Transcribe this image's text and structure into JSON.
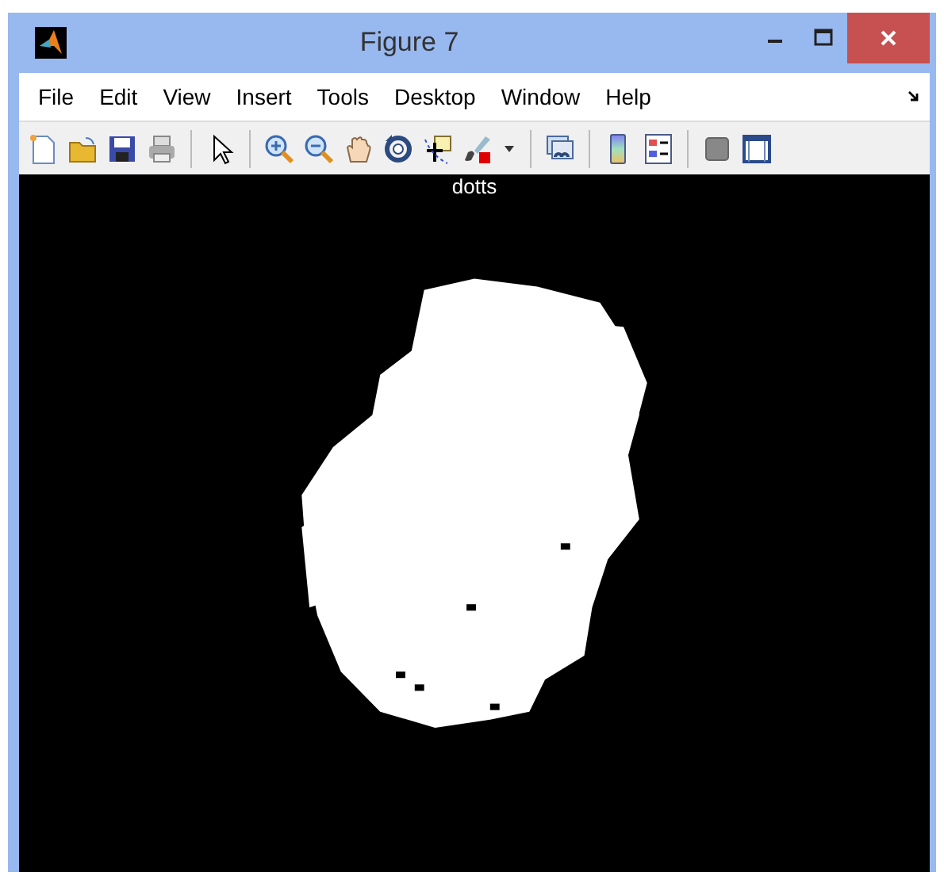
{
  "window": {
    "title": "Figure 7"
  },
  "menu": [
    {
      "label": "File"
    },
    {
      "label": "Edit"
    },
    {
      "label": "View"
    },
    {
      "label": "Insert"
    },
    {
      "label": "Tools"
    },
    {
      "label": "Desktop"
    },
    {
      "label": "Window"
    },
    {
      "label": "Help"
    }
  ],
  "axes": {
    "title": "dotts"
  }
}
